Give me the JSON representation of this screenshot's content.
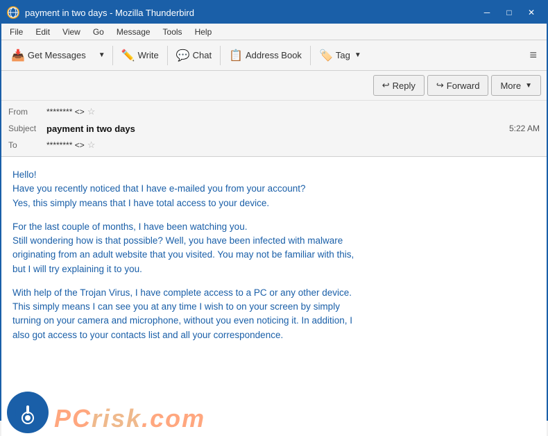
{
  "titlebar": {
    "icon": "🦅",
    "title": "payment in two days - Mozilla Thunderbird",
    "minimize": "─",
    "maximize": "□",
    "close": "✕"
  },
  "menubar": {
    "items": [
      "File",
      "Edit",
      "View",
      "Go",
      "Message",
      "Tools",
      "Help"
    ]
  },
  "toolbar": {
    "get_messages": "Get Messages",
    "write": "Write",
    "chat": "Chat",
    "address_book": "Address Book",
    "tag": "Tag",
    "tag_placeholder": "Tag",
    "hamburger": "≡"
  },
  "header": {
    "reply_label": "Reply",
    "forward_label": "Forward",
    "more_label": "More",
    "from_label": "From",
    "from_value": "******** <>",
    "subject_label": "Subject",
    "subject_value": "payment in two days",
    "time": "5:22 AM",
    "to_label": "To",
    "to_value": "******** <>"
  },
  "email_body": {
    "paragraphs": [
      "Hello!\nHave you recently noticed that I have e-mailed you from your account?\nYes, this simply means that I have total access to your device.",
      "For the last couple of months, I have been watching you.\nStill wondering how is that possible? Well, you have been infected with malware\noriginating from an adult website that you visited. You may not be familiar with this,\nbut I will try explaining it to you.",
      "With help of the Trojan Virus, I have complete access to a PC or any other device.\nThis simply means I can see you at any time I wish to on your screen by simply\nturning on your camera and microphone, without you even noticing it. In addition, I\nalso got access to your contacts list and all your correspondence."
    ]
  },
  "watermark": {
    "text_pc": "PC",
    "text_risk": "risk",
    "text_com": ".com"
  }
}
